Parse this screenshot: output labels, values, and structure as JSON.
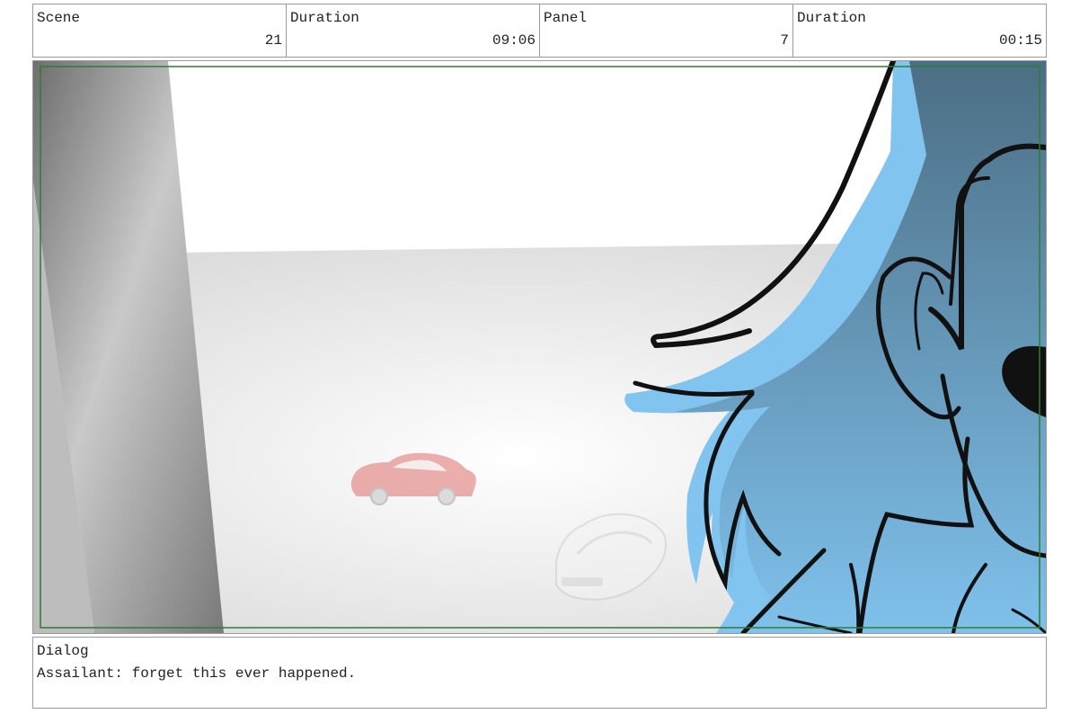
{
  "header": {
    "scene_label": "Scene",
    "scene_value": "21",
    "scene_duration_label": "Duration",
    "scene_duration_value": "09:06",
    "panel_label": "Panel",
    "panel_value": "7",
    "panel_duration_label": "Duration",
    "panel_duration_value": "00:15"
  },
  "dialog": {
    "label": "Dialog",
    "text": "Assailant: forget this ever happened."
  },
  "colors": {
    "border": "#9a9a9a",
    "safe_frame": "#2e7d32",
    "character_blue_light": "#82c4f0",
    "character_blue_dark": "#4e7288",
    "car_red": "#d9534f"
  }
}
